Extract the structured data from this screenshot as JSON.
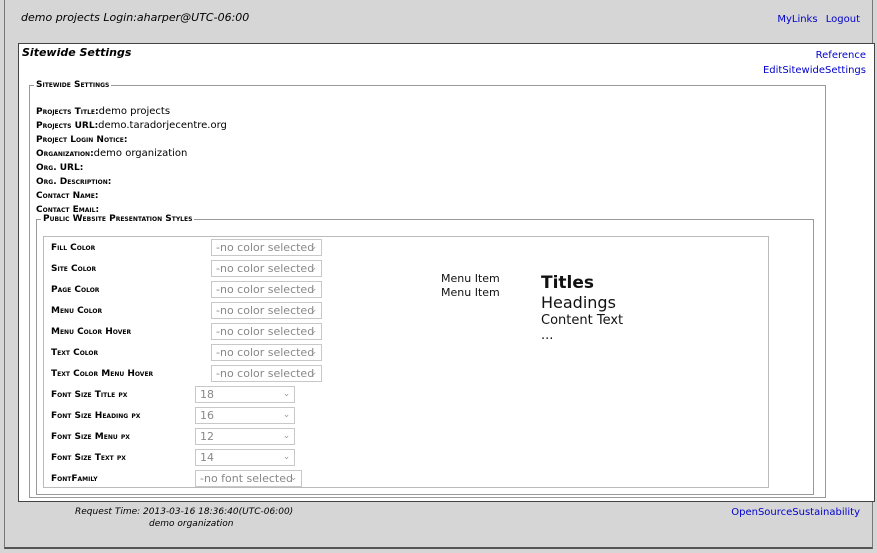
{
  "header": {
    "title": "demo projects Login:aharper@UTC-06:00",
    "links": [
      "MyLinks",
      "Logout"
    ]
  },
  "page": {
    "title": "Sitewide Settings",
    "links": [
      "Reference",
      "EditSitewideSettings"
    ]
  },
  "settings": {
    "legend": "Sitewide Settings",
    "fields": [
      {
        "label": "Projects Title:",
        "value": "demo projects"
      },
      {
        "label": "Projects URL:",
        "value": "demo.taradorjecentre.org"
      },
      {
        "label": "Project Login Notice:",
        "value": ""
      },
      {
        "label": "Organization:",
        "value": "demo organization"
      },
      {
        "label": "Org. URL:",
        "value": ""
      },
      {
        "label": "Org. Description:",
        "value": ""
      },
      {
        "label": "Contact Name:",
        "value": ""
      },
      {
        "label": "Contact Email:",
        "value": ""
      }
    ]
  },
  "styles": {
    "legend": "Public Website Presentation Styles",
    "rows": [
      {
        "label": "Fill Color",
        "value": "-no color selected"
      },
      {
        "label": "Site Color",
        "value": "-no color selected"
      },
      {
        "label": "Page Color",
        "value": "-no color selected"
      },
      {
        "label": "Menu Color",
        "value": "-no color selected"
      },
      {
        "label": "Menu Color Hover",
        "value": "-no color selected"
      },
      {
        "label": "Text Color",
        "value": "-no color selected"
      },
      {
        "label": "Text Color Menu Hover",
        "value": "-no color selected"
      },
      {
        "label": "Font Size Title px",
        "value": "18"
      },
      {
        "label": "Font Size Heading px",
        "value": "16"
      },
      {
        "label": "Font Size Menu px",
        "value": "12"
      },
      {
        "label": "Font Size Text px",
        "value": "14"
      },
      {
        "label": "FontFamily",
        "value": "-no font selected"
      }
    ]
  },
  "preview": {
    "menu_items": [
      "Menu Item",
      "Menu Item"
    ],
    "title": "Titles",
    "heading": "Headings",
    "content": "Content Text",
    "ellipsis": "..."
  },
  "footer": {
    "request_time": "Request Time: 2013-03-16 18:36:40(UTC-06:00)",
    "org": "demo organization",
    "link": "OpenSourceSustainability"
  },
  "icons": {
    "dropdown": "chevron-down-icon"
  }
}
